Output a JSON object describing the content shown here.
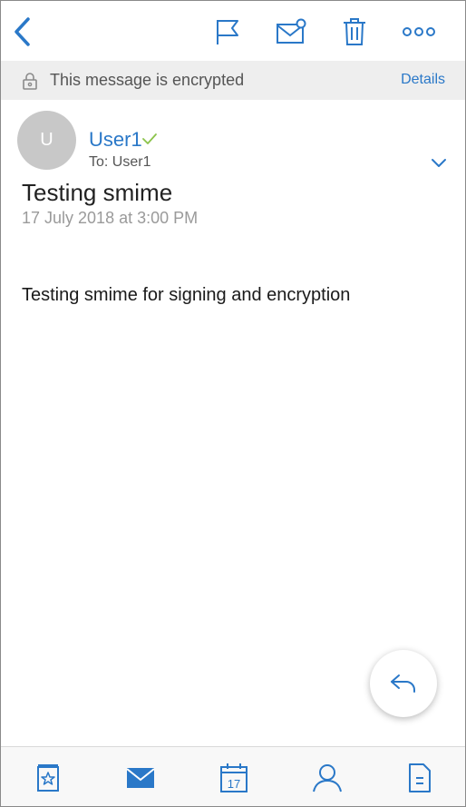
{
  "toolbar": {
    "back_icon": "chevron-left-icon",
    "flag_icon": "flag-icon",
    "mark_icon": "mail-unread-icon",
    "delete_icon": "trash-icon",
    "more_icon": "more-horizontal-icon"
  },
  "banner": {
    "lock_icon": "lock-icon",
    "text": "This message is encrypted",
    "details_label": "Details"
  },
  "message": {
    "avatar_initial": "U",
    "sender_name": "User1",
    "verified_icon": "checkmark-icon",
    "recipient": "To: User1",
    "expand_icon": "chevron-down-icon",
    "subject": "Testing smime",
    "date": "17 July 2018 at 3:00 PM",
    "body": "Testing smime for signing and encryption"
  },
  "reply_button": {
    "icon": "reply-icon"
  },
  "tabs": [
    {
      "name": "favorites",
      "icon": "favorites-icon"
    },
    {
      "name": "mail",
      "icon": "mail-icon",
      "selected": true
    },
    {
      "name": "calendar",
      "icon": "calendar-icon",
      "day": "17"
    },
    {
      "name": "people",
      "icon": "person-icon"
    },
    {
      "name": "files",
      "icon": "document-icon"
    }
  ],
  "colors": {
    "accent": "#2a78c8",
    "banner_bg": "#eeeeee",
    "verified": "#8bc34a",
    "muted_text": "#9a9a9a"
  }
}
